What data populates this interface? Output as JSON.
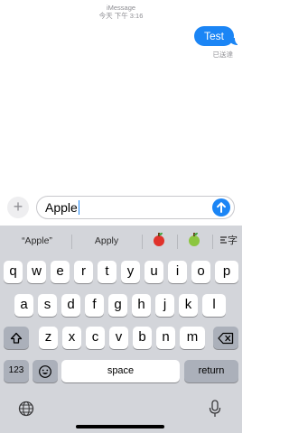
{
  "conversation": {
    "service": "iMessage",
    "timestamp": "今天 下午 3:16",
    "message": "Test",
    "status": "已送達"
  },
  "composer": {
    "plus_icon": "plus-icon",
    "text": "Apple",
    "send_icon": "arrow-up-icon"
  },
  "suggestions": [
    "“Apple”",
    "Apply"
  ],
  "emoji_suggestions": [
    {
      "name": "red-apple-emoji",
      "color": "#e0322b"
    },
    {
      "name": "green-apple-emoji",
      "color": "#8cc63f"
    }
  ],
  "handwriting_label": "字",
  "keyboard": {
    "row1": [
      "q",
      "w",
      "e",
      "r",
      "t",
      "y",
      "u",
      "i",
      "o",
      "p"
    ],
    "row2": [
      "a",
      "s",
      "d",
      "f",
      "g",
      "h",
      "j",
      "k",
      "l"
    ],
    "row3": [
      "z",
      "x",
      "c",
      "v",
      "b",
      "n",
      "m"
    ],
    "numbers_label": "123",
    "space_label": "space",
    "return_label": "return",
    "shift_icon": "shift-icon",
    "delete_icon": "delete-icon",
    "emoji_icon": "emoji-icon",
    "globe_icon": "globe-icon",
    "mic_icon": "microphone-icon"
  },
  "colors": {
    "accent": "#1b85f5",
    "keyboard_bg": "#d3d5da",
    "function_key": "#abb0ba"
  }
}
